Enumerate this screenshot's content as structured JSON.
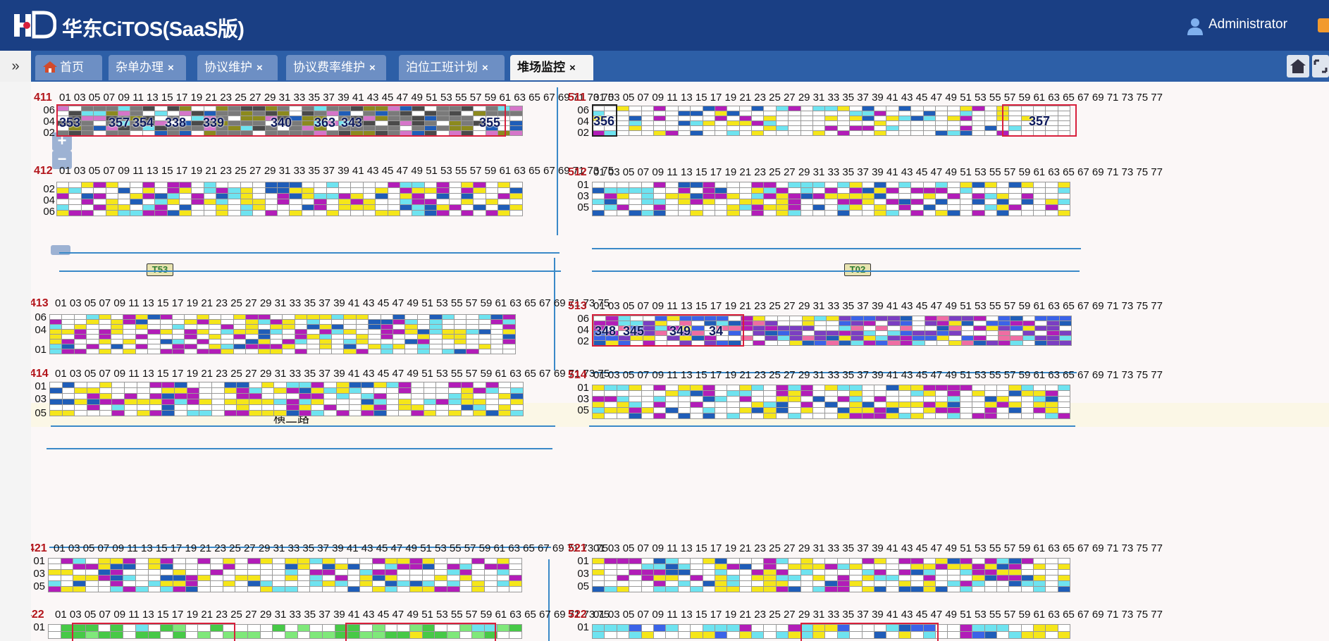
{
  "header": {
    "app_title": "华东CiTOS(SaaS版)",
    "logo_icon": "hd-logo-icon",
    "user_name": "Administrator",
    "brand_color": "#1a3f84"
  },
  "tabs": [
    {
      "label": "首页",
      "icon": "home-icon",
      "closable": false,
      "active": false
    },
    {
      "label": "杂单办理",
      "closable": true,
      "active": false
    },
    {
      "label": "协议维护",
      "closable": true,
      "active": false
    },
    {
      "label": "协议费率维护",
      "closable": true,
      "active": false
    },
    {
      "label": "泊位工班计划",
      "closable": true,
      "active": false
    },
    {
      "label": "堆场监控",
      "closable": true,
      "active": true
    }
  ],
  "close_glyph": "×",
  "collapse_glyph": "»",
  "map_controls": {
    "zoom_in": "+",
    "zoom_out": "−"
  },
  "road_label": "横二路",
  "cranes": [
    {
      "label": "T53"
    },
    {
      "label": "T02"
    }
  ],
  "blocks": [
    {
      "id": "411",
      "rows": [
        "06",
        "04",
        "02"
      ],
      "bays": 38,
      "labels": [
        "353",
        "357",
        "354",
        "338",
        "339",
        "340",
        "363",
        "343",
        "355"
      ]
    },
    {
      "id": "412",
      "rows": [
        "02",
        "04",
        "06"
      ],
      "bays": 38,
      "labels": []
    },
    {
      "id": "413",
      "rows": [
        "06",
        "04",
        "01"
      ],
      "bays": 38,
      "labels": []
    },
    {
      "id": "414",
      "rows": [
        "01",
        "03",
        "05"
      ],
      "bays": 38,
      "labels": []
    },
    {
      "id": "421",
      "rows": [
        "01",
        "03",
        "05"
      ],
      "bays": 38,
      "labels": []
    },
    {
      "id": "422",
      "rows": [
        "01"
      ],
      "bays": 38,
      "labels": []
    },
    {
      "id": "511",
      "rows": [
        "06",
        "04",
        "02"
      ],
      "bays": 39,
      "labels": [
        "356",
        "357"
      ]
    },
    {
      "id": "512",
      "rows": [
        "01",
        "03",
        "05"
      ],
      "bays": 39,
      "labels": []
    },
    {
      "id": "513",
      "rows": [
        "06",
        "04",
        "02"
      ],
      "bays": 39,
      "labels": [
        "348",
        "345",
        "349",
        "34"
      ]
    },
    {
      "id": "514",
      "rows": [
        "01",
        "03",
        "05"
      ],
      "bays": 39,
      "labels": []
    },
    {
      "id": "521",
      "rows": [
        "01",
        "03",
        "05"
      ],
      "bays": 39,
      "labels": []
    },
    {
      "id": "522",
      "rows": [
        "01"
      ],
      "bays": 39,
      "labels": []
    }
  ],
  "bay_numbers_75": "01 03 05 07 09 11 13 15 17 19 21 23 25 27 29 31 33 35 37 39 41 43 45 47 49 51 53 55 57 59 61 63 65 67 69 71 73 75",
  "bay_numbers_77": "01 03 05 07 09 11 13 15 17 19 21 23 25 27 29 31 33 35 37 39 41 43 45 47 49 51 53 55 57 59 61 63 65 67 69 71 73 75 77",
  "palette": {
    "yellow": "#f5e61a",
    "magenta": "#b21db8",
    "blue": "#1f5db8",
    "cyan": "#6ee3f0",
    "highlight_border": "#d8203c",
    "lane_line": "#3a89c8"
  }
}
